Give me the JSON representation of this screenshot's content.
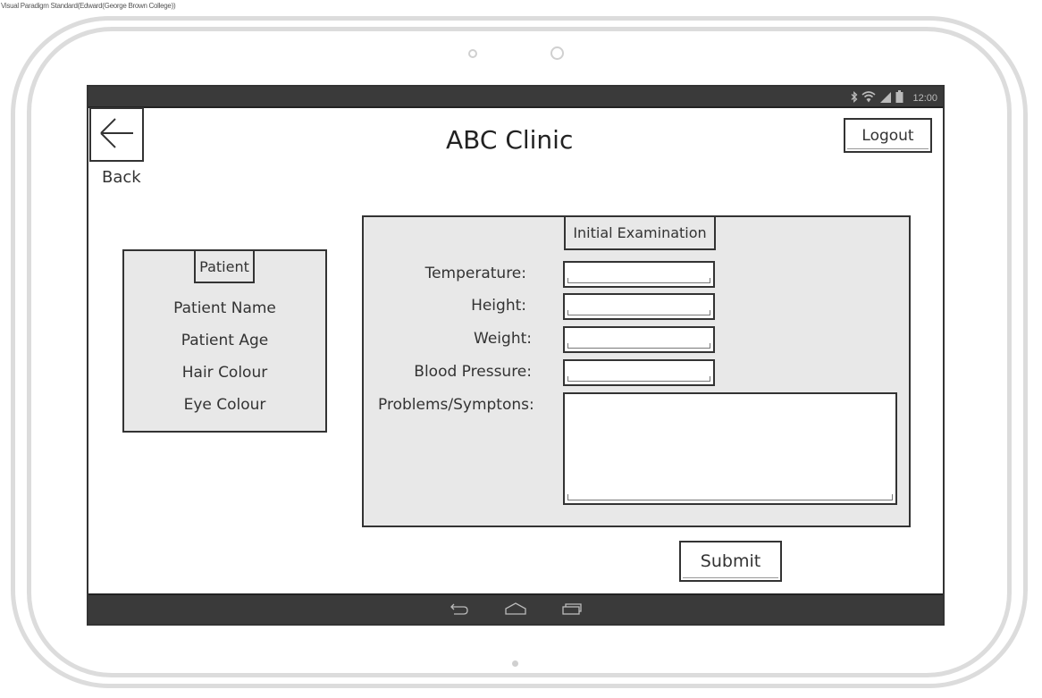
{
  "watermark": "Visual Paradigm Standard(Edward(George Brown College))",
  "status_bar": {
    "time": "12:00",
    "icons": [
      "bluetooth-icon",
      "wifi-icon",
      "signal-icon",
      "battery-icon"
    ]
  },
  "header": {
    "back_label": "Back",
    "back_icon": "arrow-left-icon",
    "title": "ABC Clinic",
    "logout_label": "Logout"
  },
  "patient_panel": {
    "title": "Patient",
    "fields": [
      "Patient Name",
      "Patient Age",
      "Hair Colour",
      "Eye Colour"
    ]
  },
  "exam_panel": {
    "title": "Initial Examination",
    "fields": [
      {
        "label": "Temperature:",
        "value": ""
      },
      {
        "label": "Height:",
        "value": ""
      },
      {
        "label": "Weight:",
        "value": ""
      },
      {
        "label": "Blood Pressure:",
        "value": ""
      }
    ],
    "problems_label": "Problems/Symptons:",
    "problems_value": ""
  },
  "submit_label": "Submit",
  "nav_bar": {
    "icons": [
      "back-nav-icon",
      "home-nav-icon",
      "recents-nav-icon"
    ]
  },
  "colors": {
    "bar": "#3a3a3a",
    "panel": "#e8e8e8",
    "frame": "#dcdcdc",
    "border": "#333333"
  }
}
